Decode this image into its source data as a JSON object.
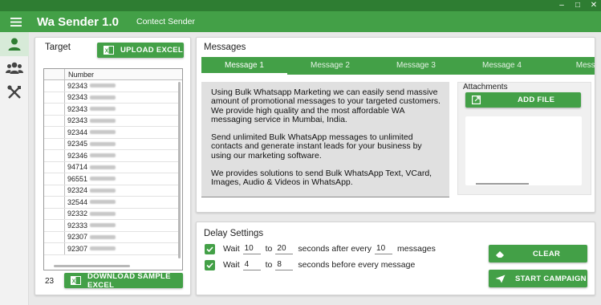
{
  "app": {
    "title": "Wa Sender 1.0",
    "subtitle": "Contect Sender"
  },
  "window_controls": [
    "minimize-icon",
    "maximize-icon",
    "close-icon"
  ],
  "sidebar": {
    "items": [
      {
        "icon": "user-icon",
        "active": true
      },
      {
        "icon": "group-icon",
        "active": false
      },
      {
        "icon": "tools-icon",
        "active": false
      }
    ]
  },
  "target": {
    "title": "Target",
    "upload_label": "UPLOAD EXCEL",
    "column_header": "Number",
    "rows": [
      "92343",
      "92343",
      "92343",
      "92343",
      "92344",
      "92345",
      "92346",
      "94714",
      "96551",
      "92324",
      "32544",
      "92332",
      "92333",
      "92307",
      "92307"
    ],
    "count": "23",
    "download_label": "DOWNLOAD SAMPLE EXCEL"
  },
  "messages": {
    "title": "Messages",
    "tabs": [
      "Message 1",
      "Message 2",
      "Message 3",
      "Message 4",
      "Messa"
    ],
    "active_tab": 0,
    "body": [
      "Using Bulk Whatsapp Marketing we can easily send massive amount of promotional messages to your targeted customers. We provide high quality and the most affordable WA messaging service in Mumbai, India.",
      "Send unlimited Bulk WhatsApp messages to unlimited contacts and generate instant leads for your business by using our marketing software.",
      "We  provides solutions to send Bulk WhatsApp Text, VCard, Images, Audio & Videos in WhatsApp."
    ],
    "attachments_title": "Attachments",
    "add_file_label": "ADD FILE"
  },
  "delay": {
    "title": "Delay Settings",
    "row1": {
      "checked": true,
      "wait_label": "Wait",
      "min": "10",
      "to_label": "to",
      "max": "20",
      "after_label": "seconds after every",
      "count": "10",
      "messages_label": "messages"
    },
    "row2": {
      "checked": true,
      "wait_label": "Wait",
      "min": "4",
      "to_label": "to",
      "max": "8",
      "before_label": "seconds before every message"
    },
    "clear_label": "CLEAR",
    "start_label": "START CAMPAIGN"
  },
  "colors": {
    "primary": "#43a047",
    "primary_dark": "#2e7d32"
  }
}
